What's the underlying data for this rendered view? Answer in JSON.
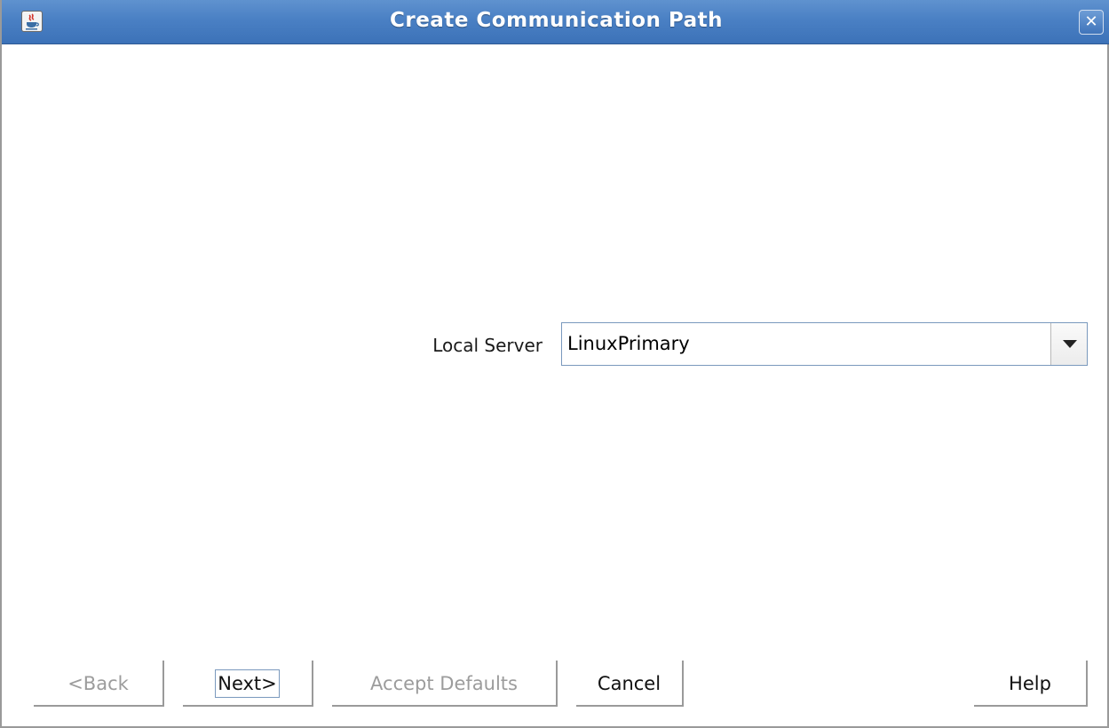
{
  "window": {
    "title": "Create Communication Path",
    "app_icon": "java-icon",
    "close_icon": "close-icon",
    "close_glyph": "✕"
  },
  "form": {
    "local_server_label": "Local Server",
    "local_server_value": "LinuxPrimary"
  },
  "buttons": {
    "back": "<Back",
    "next": "Next>",
    "accept_defaults": "Accept Defaults",
    "cancel": "Cancel",
    "help": "Help"
  },
  "colors": {
    "titlebar": "#4a80c4",
    "disabled_text": "#9c9c9c",
    "focus_border": "#7a99bd"
  }
}
